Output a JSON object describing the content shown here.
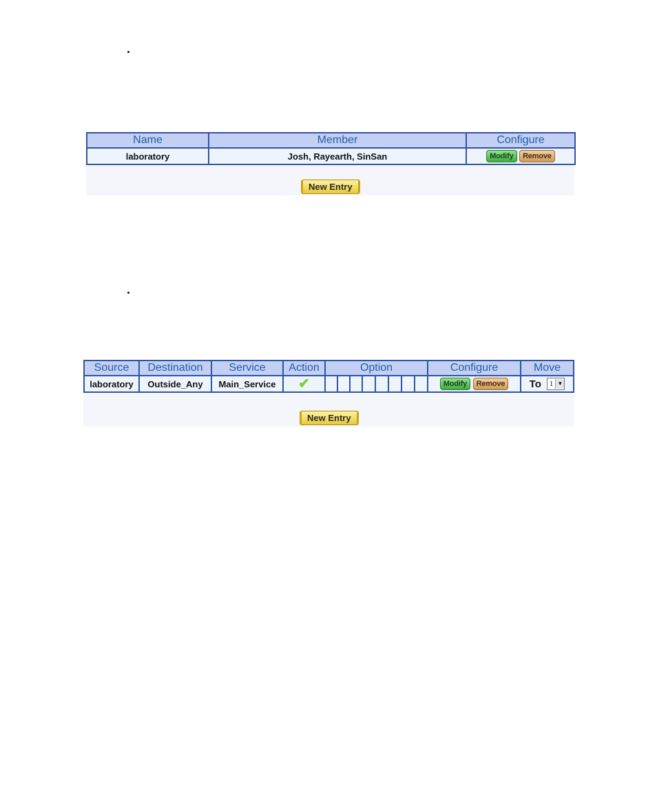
{
  "section1": {
    "table": {
      "headers": [
        "Name",
        "Member",
        "Configure"
      ],
      "rows": [
        {
          "name": "laboratory",
          "member": "Josh, Rayearth, SinSan"
        }
      ]
    },
    "buttons": {
      "modify": "Modify",
      "remove": "Remove",
      "new_entry": "New Entry"
    }
  },
  "section2": {
    "table": {
      "headers": [
        "Source",
        "Destination",
        "Service",
        "Action",
        "Option",
        "Configure",
        "Move"
      ],
      "rows": [
        {
          "source": "laboratory",
          "destination": "Outside_Any",
          "service": "Main_Service",
          "action_icon": "checkmark-icon",
          "option_cells": 8,
          "move_label": "To",
          "move_value": "1"
        }
      ]
    },
    "buttons": {
      "modify": "Modify",
      "remove": "Remove",
      "new_entry": "New Entry"
    }
  },
  "colors": {
    "header_bg": "#c3cff3",
    "header_text": "#1f5fa8",
    "border": "#2f54a0",
    "modify_green": "#3fae3f",
    "remove_tan": "#cf9b5a",
    "new_entry_yellow": "#e7c93a"
  }
}
